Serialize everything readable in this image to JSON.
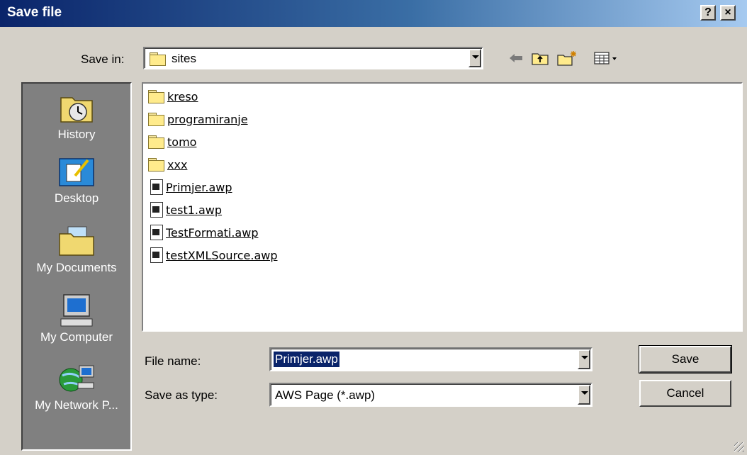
{
  "window": {
    "title": "Save file",
    "help_label": "?",
    "close_label": "×"
  },
  "save_in": {
    "label": "Save in:",
    "value": "sites"
  },
  "toolbar": {
    "back_icon": "back-arrow-icon",
    "up_icon": "up-folder-icon",
    "new_folder_icon": "new-folder-icon",
    "view_icon": "view-menu-icon"
  },
  "places": [
    {
      "label": "History",
      "icon": "history-icon"
    },
    {
      "label": "Desktop",
      "icon": "desktop-icon"
    },
    {
      "label": "My Documents",
      "icon": "my-documents-icon"
    },
    {
      "label": "My Computer",
      "icon": "my-computer-icon"
    },
    {
      "label": "My Network P...",
      "icon": "network-places-icon"
    }
  ],
  "files": [
    {
      "name": "kreso",
      "type": "folder"
    },
    {
      "name": "programiranje",
      "type": "folder"
    },
    {
      "name": "tomo",
      "type": "folder"
    },
    {
      "name": "xxx",
      "type": "folder"
    },
    {
      "name": "Primjer.awp",
      "type": "file"
    },
    {
      "name": "test1.awp",
      "type": "file"
    },
    {
      "name": "TestFormati.awp",
      "type": "file"
    },
    {
      "name": "testXMLSource.awp",
      "type": "file"
    }
  ],
  "form": {
    "file_name_label": "File name:",
    "file_name_value": "Primjer.awp",
    "save_type_label": "Save as type:",
    "save_type_value": "AWS Page (*.awp)"
  },
  "buttons": {
    "save": "Save",
    "cancel": "Cancel"
  },
  "colors": {
    "title_start": "#0a246a",
    "title_end": "#a6caf0",
    "face": "#d4d0c8",
    "places_bg": "#808080",
    "selection": "#0a246a"
  }
}
